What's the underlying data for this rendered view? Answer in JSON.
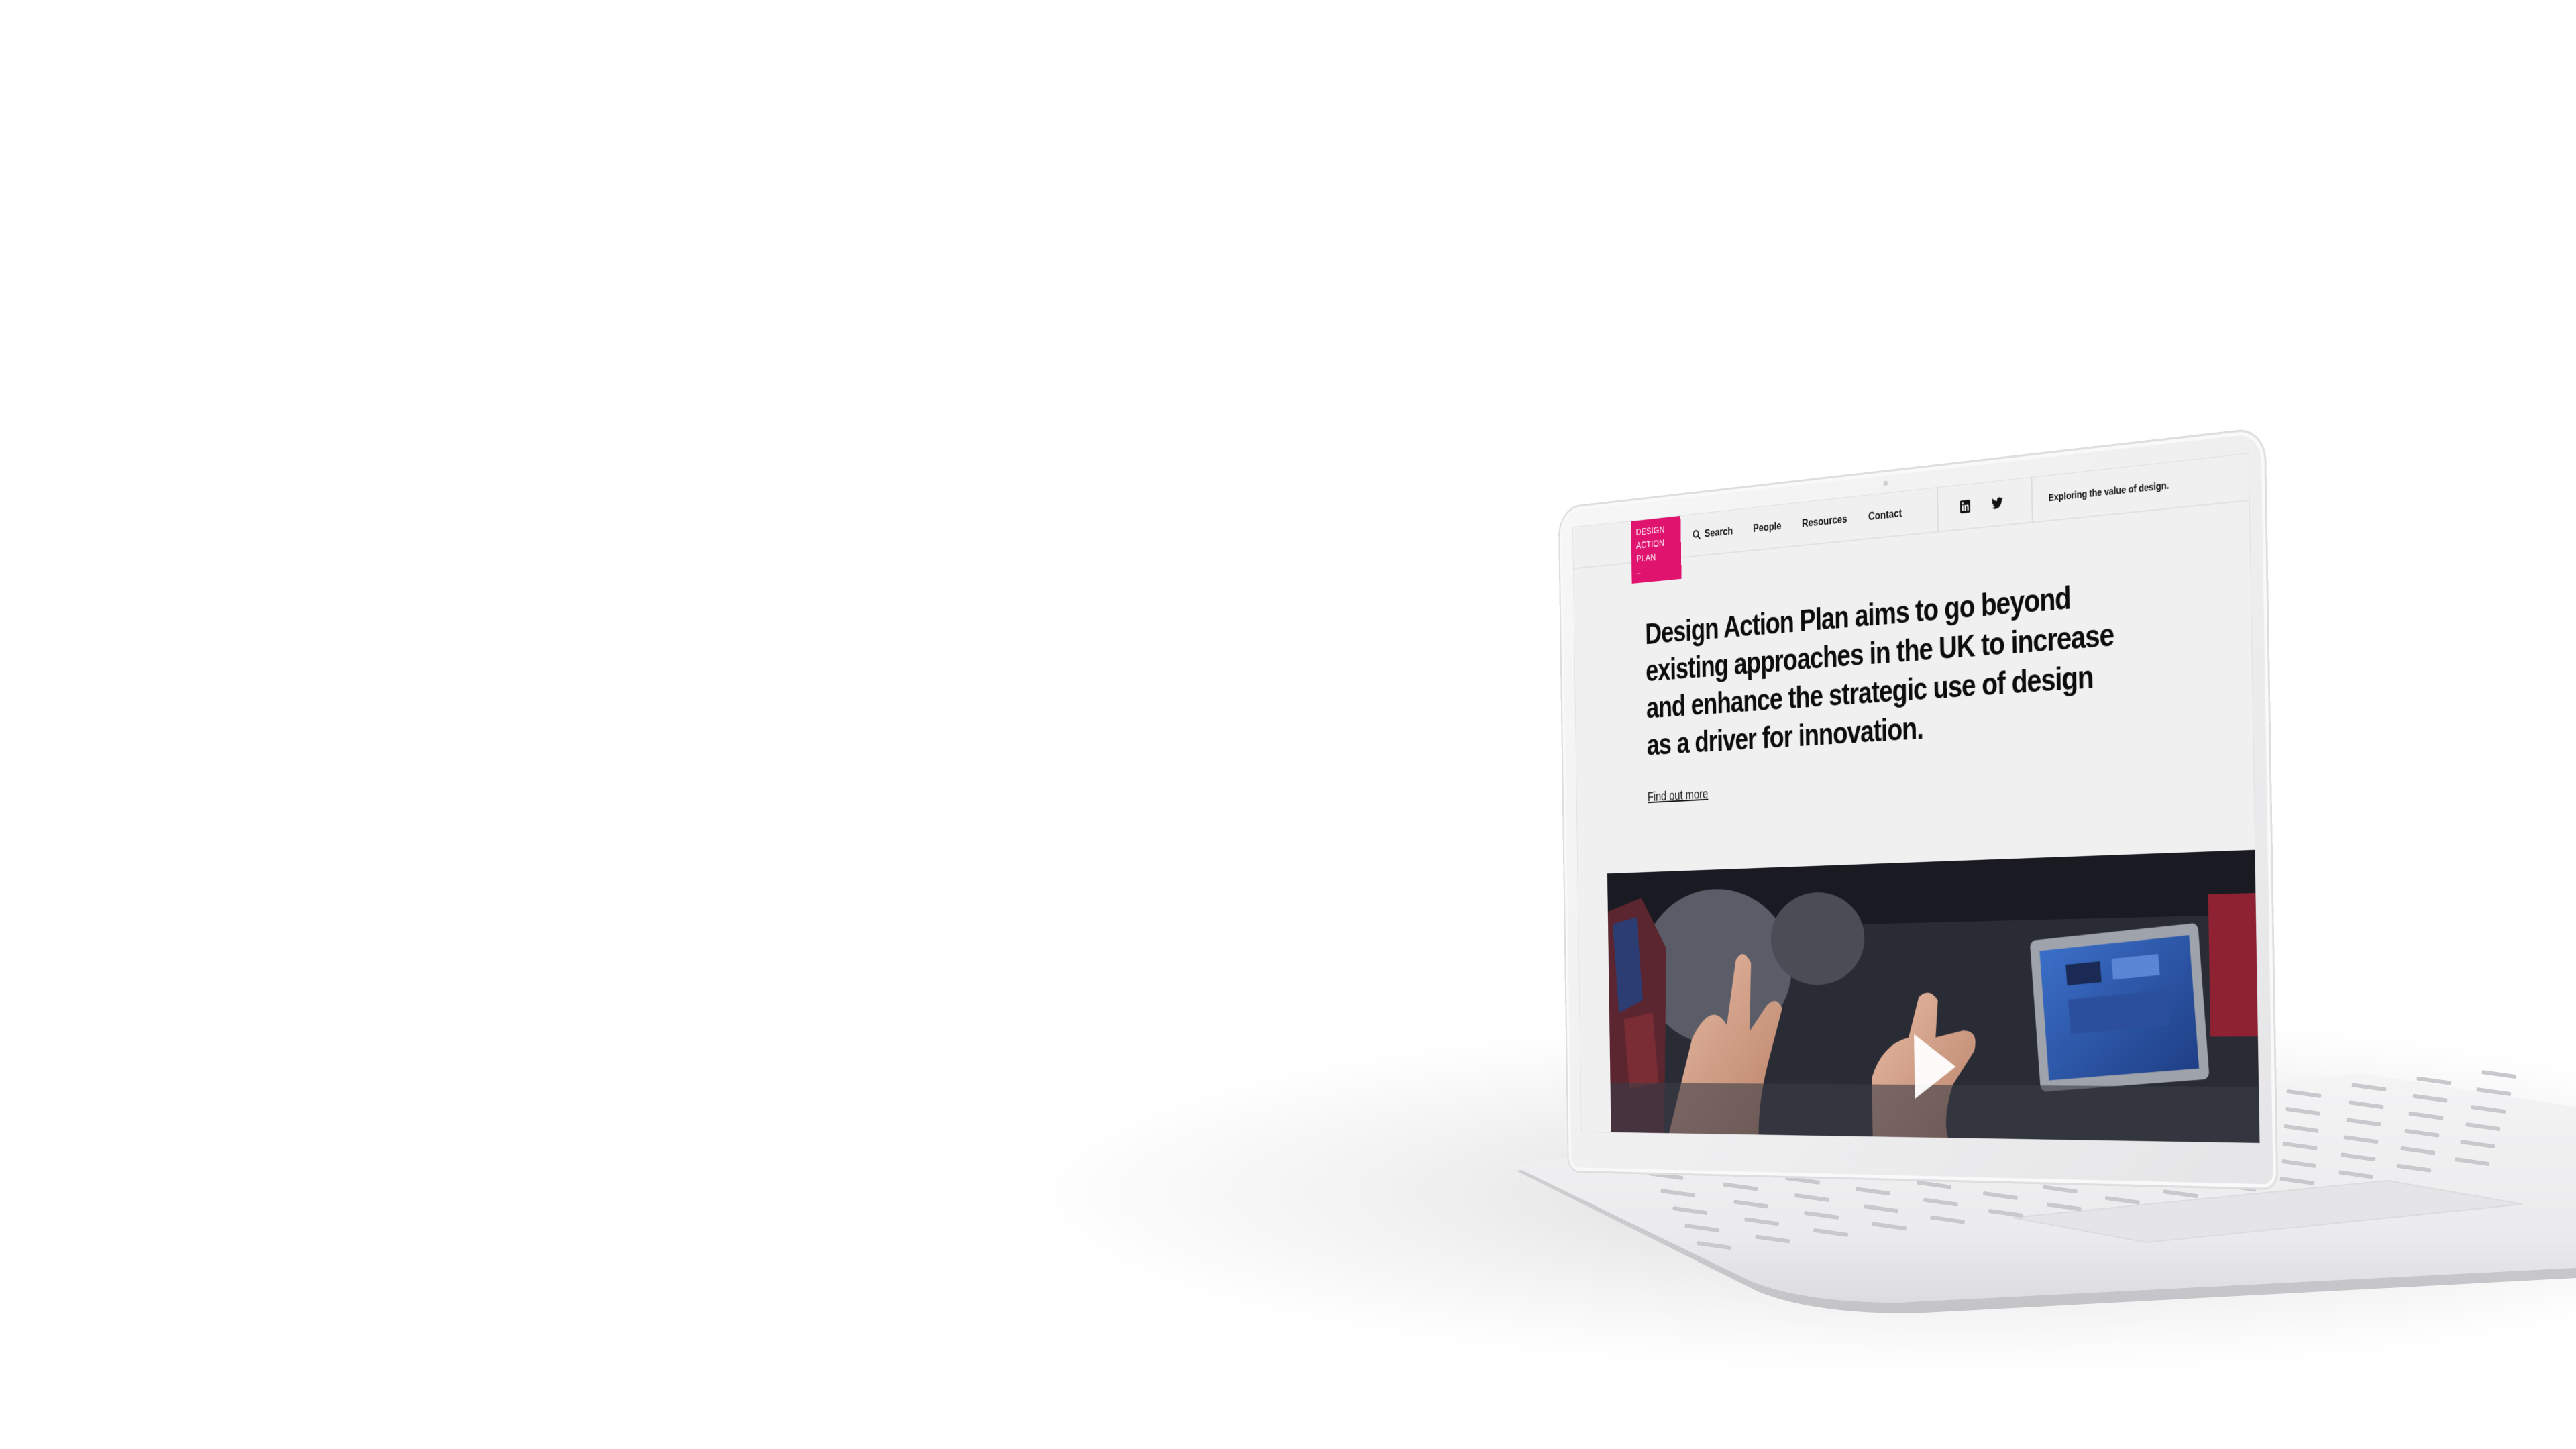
{
  "site": {
    "logo": {
      "lines": [
        "DESIGN",
        "ACTION",
        "PLAN",
        "_"
      ],
      "color": "#e0136f"
    },
    "nav": {
      "search_label": "Search",
      "search_icon": "search-icon",
      "items": [
        "People",
        "Resources",
        "Contact"
      ]
    },
    "social": {
      "icons": [
        "linkedin-icon",
        "twitter-icon"
      ]
    },
    "tagline": "Exploring the value of design.",
    "hero": {
      "title": "Design Action Plan aims to go beyond existing approaches in the UK to increase and enhance the strategic use of design as a driver for innovation.",
      "link_label": "Find out more"
    },
    "video": {
      "play_icon": "play-icon"
    }
  },
  "colors": {
    "accent": "#e0136f",
    "text": "#0c0c0c",
    "background": "#f0f0f1"
  }
}
